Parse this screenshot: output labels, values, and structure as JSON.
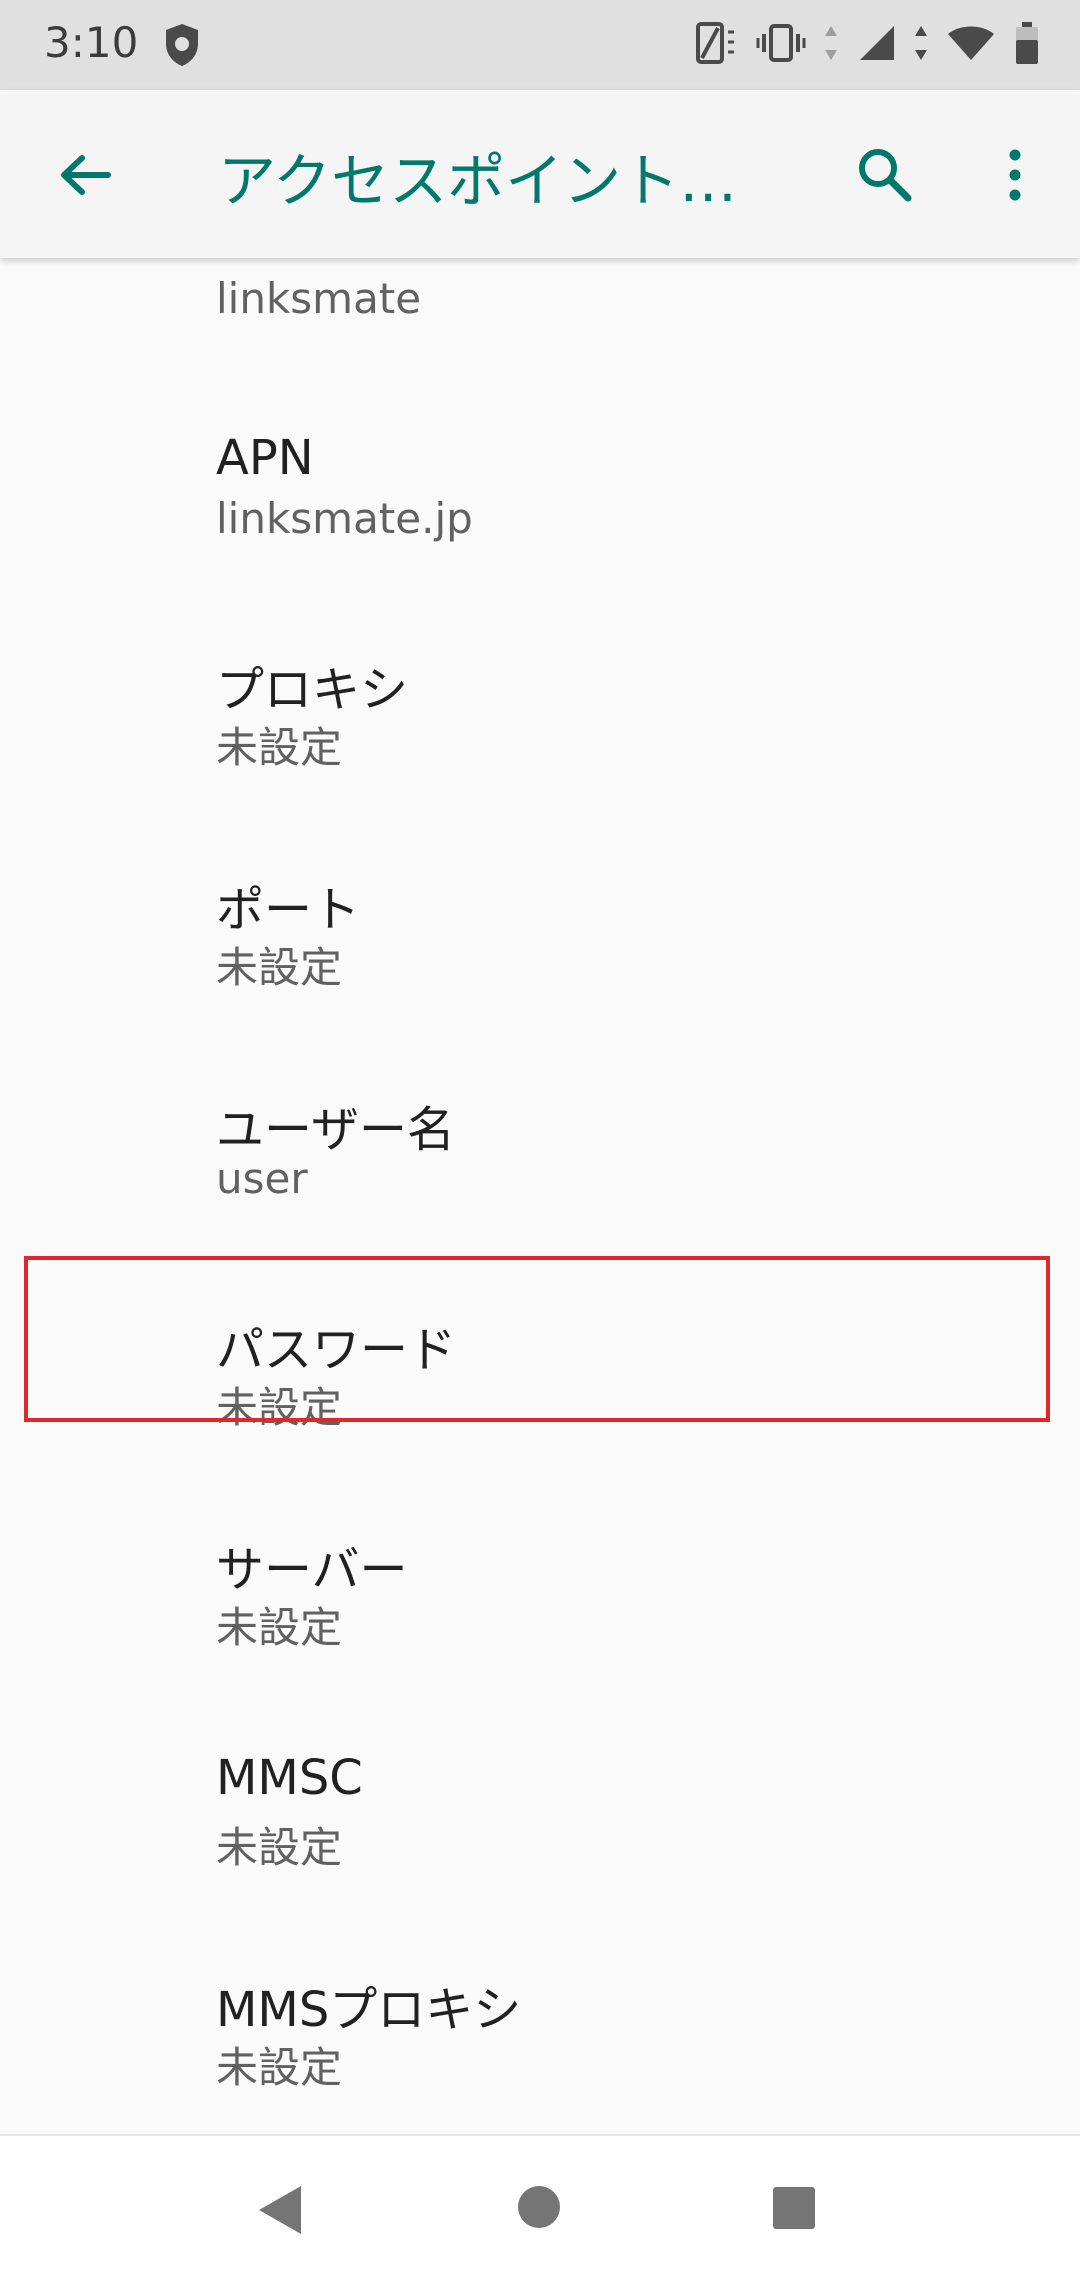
{
  "status_bar": {
    "time": "3:10"
  },
  "app_bar": {
    "title": "アクセスポイント…",
    "back_icon": "arrow-back-icon",
    "search_icon": "search-icon",
    "more_icon": "more-vert-icon"
  },
  "list": {
    "partial_item_summary": "linksmate",
    "items": [
      {
        "title": "APN",
        "summary": "linksmate.jp"
      },
      {
        "title": "プロキシ",
        "summary": "未設定"
      },
      {
        "title": "ポート",
        "summary": "未設定"
      },
      {
        "title": "ユーザー名",
        "summary": "user"
      },
      {
        "title": "パスワード",
        "summary": "未設定"
      },
      {
        "title": "サーバー",
        "summary": "未設定"
      },
      {
        "title": "MMSC",
        "summary": "未設定"
      },
      {
        "title": "MMSプロキシ",
        "summary": "未設定"
      }
    ]
  },
  "colors": {
    "accent": "#00796b",
    "highlight": "#e02828"
  }
}
